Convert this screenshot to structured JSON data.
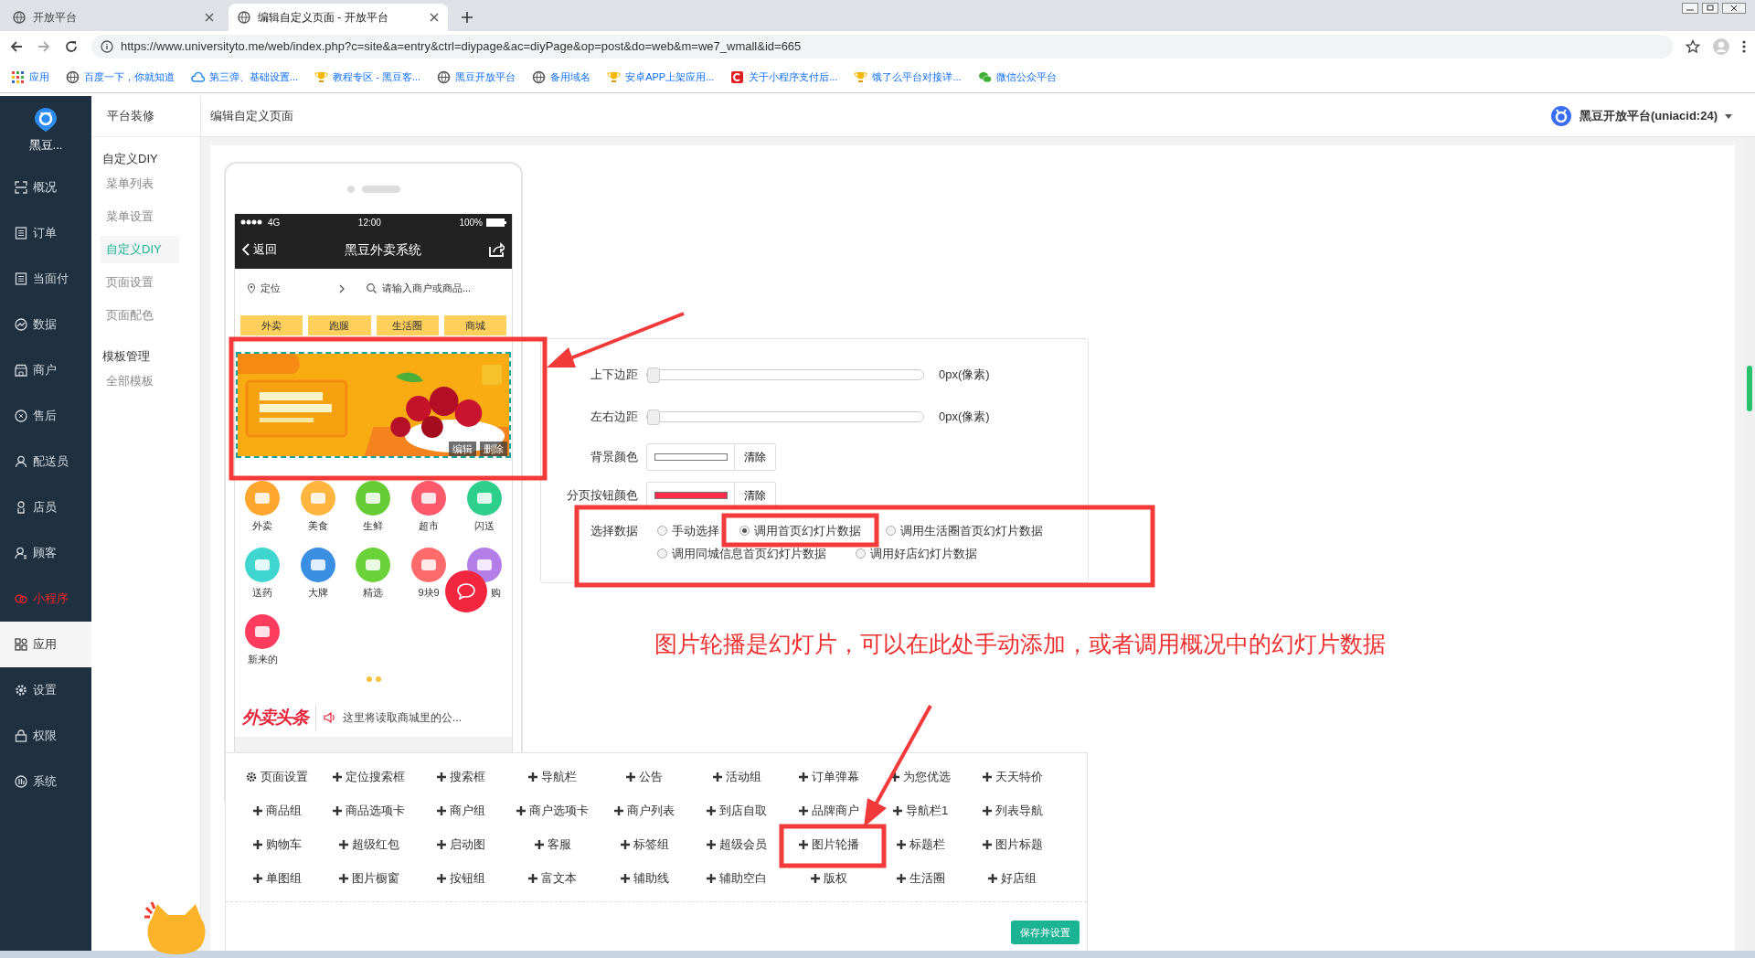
{
  "browser": {
    "tabs": [
      {
        "title": "开放平台",
        "selected": false
      },
      {
        "title": "编辑自定义页面 - 开放平台",
        "selected": true
      }
    ],
    "url": "https://www.universityto.me/web/index.php?c=site&a=entry&ctrl=diypage&ac=diyPage&op=post&do=web&m=we7_wmall&id=665",
    "bookmarks": [
      {
        "label": "应用"
      },
      {
        "label": "百度一下，你就知道"
      },
      {
        "label": "第三弹、基础设置..."
      },
      {
        "label": "教程专区 - 黑豆客..."
      },
      {
        "label": "黑豆开放平台"
      },
      {
        "label": "备用域名"
      },
      {
        "label": "安卓APP上架应用..."
      },
      {
        "label": "关于小程序支付后..."
      },
      {
        "label": "饿了么平台对接详..."
      },
      {
        "label": "微信公众平台"
      }
    ]
  },
  "sidebar": {
    "brand": "黑豆...",
    "items": [
      {
        "label": "概况",
        "selected": false,
        "highlighted": false
      },
      {
        "label": "订单",
        "selected": false,
        "highlighted": false
      },
      {
        "label": "当面付",
        "selected": false,
        "highlighted": false
      },
      {
        "label": "数据",
        "selected": false,
        "highlighted": false
      },
      {
        "label": "商户",
        "selected": false,
        "highlighted": false
      },
      {
        "label": "售后",
        "selected": false,
        "highlighted": false
      },
      {
        "label": "配送员",
        "selected": false,
        "highlighted": false
      },
      {
        "label": "店员",
        "selected": false,
        "highlighted": false
      },
      {
        "label": "顾客",
        "selected": false,
        "highlighted": false
      },
      {
        "label": "小程序",
        "selected": false,
        "highlighted": true
      },
      {
        "label": "应用",
        "selected": true,
        "highlighted": false
      },
      {
        "label": "设置",
        "selected": false,
        "highlighted": false
      },
      {
        "label": "权限",
        "selected": false,
        "highlighted": false
      },
      {
        "label": "系统",
        "selected": false,
        "highlighted": false
      }
    ]
  },
  "subnav": {
    "title": "平台装修",
    "groups": [
      {
        "label": "自定义DIY",
        "children": [
          {
            "label": "菜单列表",
            "selected": false
          },
          {
            "label": "菜单设置",
            "selected": false
          },
          {
            "label": "自定义DIY",
            "selected": true
          },
          {
            "label": "页面设置",
            "selected": false
          },
          {
            "label": "页面配色",
            "selected": false
          }
        ]
      },
      {
        "label": "模板管理",
        "children": [
          {
            "label": "全部模板",
            "selected": false
          }
        ]
      }
    ]
  },
  "header": {
    "title": "编辑自定义页面",
    "account": "黑豆开放平台(uniacid:24)"
  },
  "phone": {
    "carrier": "4G",
    "time": "12:00",
    "battery": "100%",
    "back": "返回",
    "title": "黑豆外卖系统",
    "location": "定位",
    "search_placeholder": "请输入商户或商品...",
    "tabs": [
      "外卖",
      "跑腿",
      "生活圈",
      "商城"
    ],
    "banner": {
      "kind": "picture",
      "edit": "编辑",
      "delete": "删除"
    },
    "icons": [
      {
        "label": "外卖",
        "color": "#ffa62f"
      },
      {
        "label": "美食",
        "color": "#ffb640"
      },
      {
        "label": "生鲜",
        "color": "#66cc33"
      },
      {
        "label": "超市",
        "color": "#ff5a6c"
      },
      {
        "label": "闪送",
        "color": "#2ecf8c"
      },
      {
        "label": "送药",
        "color": "#3ed6cf"
      },
      {
        "label": "大牌",
        "color": "#3b8fe3"
      },
      {
        "label": "精选",
        "color": "#6bd23a"
      },
      {
        "label": "9块9",
        "color": "#ff6b6b"
      },
      {
        "label": "购",
        "color": "#b47ee8"
      },
      {
        "label": "新来的",
        "color": "#ff3b5e"
      }
    ],
    "headline_logo": "外卖头条",
    "notice": "这里将读取商城里的公..."
  },
  "settings": {
    "sliders": [
      {
        "label": "上下边距",
        "level": 0,
        "reading": "0px(像素)"
      },
      {
        "label": "左右边距",
        "level": 0,
        "reading": "0px(像素)"
      }
    ],
    "colors": [
      {
        "label": "背景颜色",
        "color": "#ffffff",
        "clear": "清除"
      },
      {
        "label": "分页按钮颜色",
        "color": "#ff2b4a",
        "clear": "清除"
      }
    ],
    "data_source": {
      "label": "选择数据",
      "options": [
        {
          "label": "手动选择",
          "selected": false
        },
        {
          "label": "调用首页幻灯片数据",
          "selected": true
        },
        {
          "label": "调用生活圈首页幻灯片数据",
          "selected": false
        },
        {
          "label": "调用同城信息首页幻灯片数据",
          "selected": false
        },
        {
          "label": "调用好店幻灯片数据",
          "selected": false
        }
      ]
    }
  },
  "annotation": "图片轮播是幻灯片，可以在此处手动添加，或者调用概况中的幻灯片数据",
  "components": {
    "items": [
      {
        "label": "页面设置",
        "kind": "settings"
      },
      {
        "label": "定位搜索框",
        "kind": "add"
      },
      {
        "label": "搜索框",
        "kind": "add"
      },
      {
        "label": "导航栏",
        "kind": "add"
      },
      {
        "label": "公告",
        "kind": "add"
      },
      {
        "label": "活动组",
        "kind": "add"
      },
      {
        "label": "订单弹幕",
        "kind": "add"
      },
      {
        "label": "为您优选",
        "kind": "add"
      },
      {
        "label": "天天特价",
        "kind": "add"
      },
      {
        "label": "商品组",
        "kind": "add"
      },
      {
        "label": "商品选项卡",
        "kind": "add"
      },
      {
        "label": "商户组",
        "kind": "add"
      },
      {
        "label": "商户选项卡",
        "kind": "add"
      },
      {
        "label": "商户列表",
        "kind": "add"
      },
      {
        "label": "到店自取",
        "kind": "add"
      },
      {
        "label": "品牌商户",
        "kind": "add"
      },
      {
        "label": "导航栏1",
        "kind": "add"
      },
      {
        "label": "列表导航",
        "kind": "add"
      },
      {
        "label": "购物车",
        "kind": "add"
      },
      {
        "label": "超级红包",
        "kind": "add"
      },
      {
        "label": "启动图",
        "kind": "add"
      },
      {
        "label": "客服",
        "kind": "add"
      },
      {
        "label": "标签组",
        "kind": "add"
      },
      {
        "label": "超级会员",
        "kind": "add"
      },
      {
        "label": "图片轮播",
        "kind": "add"
      },
      {
        "label": "标题栏",
        "kind": "add"
      },
      {
        "label": "图片标题",
        "kind": "add"
      },
      {
        "label": "单图组",
        "kind": "add"
      },
      {
        "label": "图片橱窗",
        "kind": "add"
      },
      {
        "label": "按钮组",
        "kind": "add"
      },
      {
        "label": "富文本",
        "kind": "add"
      },
      {
        "label": "辅助线",
        "kind": "add"
      },
      {
        "label": "辅助空白",
        "kind": "add"
      },
      {
        "label": "版权",
        "kind": "add"
      },
      {
        "label": "生活圈",
        "kind": "add"
      },
      {
        "label": "好店组",
        "kind": "add"
      }
    ],
    "save": "保存并设置"
  }
}
